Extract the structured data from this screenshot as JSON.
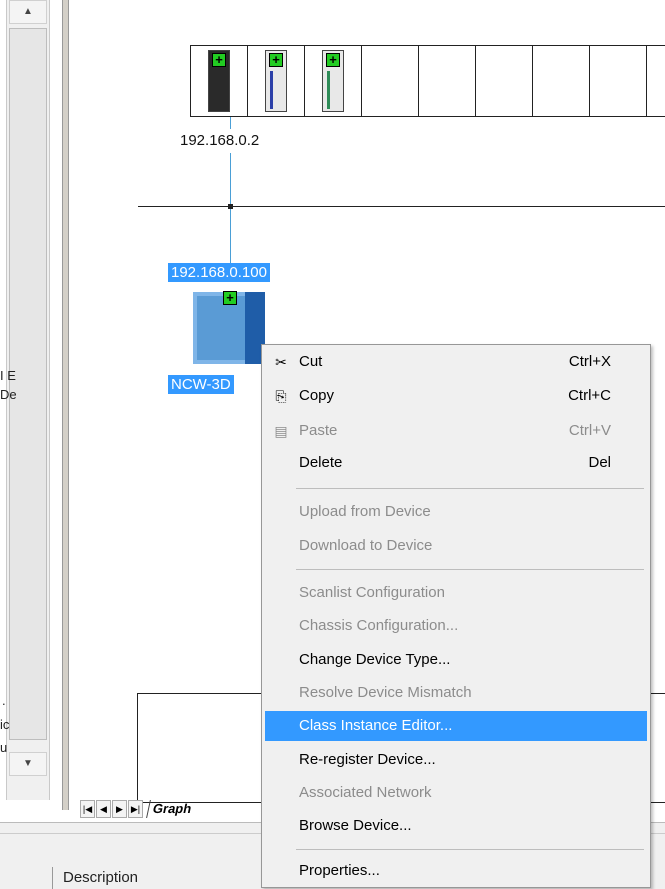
{
  "left_pane": {
    "fragments": [
      "I E",
      "De",
      ".",
      "ic",
      "u"
    ]
  },
  "graph": {
    "chassis_ip": "192.168.0.2",
    "device_ip": "192.168.0.100",
    "device_name": "NCW-3D",
    "tab_label": "Graph"
  },
  "status": {
    "column_header": "Description"
  },
  "context_menu": {
    "items": [
      {
        "label": "Cut",
        "shortcut": "Ctrl+X",
        "icon": "scissors-icon",
        "enabled": true
      },
      {
        "label": "Copy",
        "shortcut": "Ctrl+C",
        "icon": "copy-icon",
        "enabled": true
      },
      {
        "label": "Paste",
        "shortcut": "Ctrl+V",
        "icon": "paste-icon",
        "enabled": false
      },
      {
        "label": "Delete",
        "shortcut": "Del",
        "enabled": true
      },
      {
        "label": "Upload from Device",
        "enabled": false
      },
      {
        "label": "Download to Device",
        "enabled": false
      },
      {
        "label": "Scanlist Configuration",
        "enabled": false
      },
      {
        "label": "Chassis Configuration...",
        "enabled": false
      },
      {
        "label": "Change Device Type...",
        "enabled": true
      },
      {
        "label": "Resolve Device Mismatch",
        "enabled": false
      },
      {
        "label": "Class Instance Editor...",
        "enabled": true,
        "highlighted": true
      },
      {
        "label": "Re-register Device...",
        "enabled": true
      },
      {
        "label": "Associated Network",
        "enabled": false
      },
      {
        "label": "Browse Device...",
        "enabled": true
      },
      {
        "label": "Properties...",
        "enabled": true
      }
    ]
  },
  "colors": {
    "selection": "#3399ff",
    "menu_background": "#f0f0f0",
    "disabled_text": "#8c8c8c",
    "link_line": "#4a9fd6",
    "status_plus": "#22cc22"
  }
}
